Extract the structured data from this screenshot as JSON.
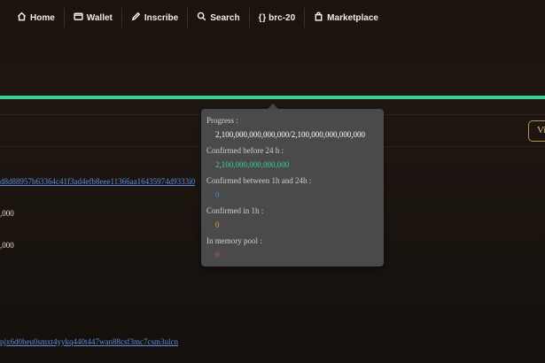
{
  "nav": {
    "items": [
      {
        "label": "Home",
        "icon": "home-icon"
      },
      {
        "label": "Wallet",
        "icon": "wallet-icon"
      },
      {
        "label": "Inscribe",
        "icon": "pencil-icon"
      },
      {
        "label": "Search",
        "icon": "search-icon"
      },
      {
        "label": "brc-20",
        "icon": "braces-icon"
      },
      {
        "label": "Marketplace",
        "icon": "bag-icon"
      }
    ]
  },
  "progress": {
    "fraction": 1.0,
    "color": "#3fcf94"
  },
  "view_button": {
    "label": "Vi"
  },
  "rows": {
    "hash": "d8d88957b63364c41f3ad4efb8eee11366aa16435974d9333i0",
    "amount_1": ",000",
    "amount_2": ",000",
    "address": "pjx6d0heu0smxt4yykq440t447wan88csf3mc7csm3ulcn"
  },
  "tooltip": {
    "progress_label": "Progress :",
    "progress_value": "2,100,000,000,000,000/2,100,000,000,000,000",
    "confirmed_24h_label": "Confirmed before 24 h :",
    "confirmed_24h_value": "2,100,000,000,000,000",
    "confirmed_1h_24h_label": "Confirmed between 1h and 24h :",
    "confirmed_1h_24h_value": "0",
    "confirmed_1h_label": "Confirmed in 1h :",
    "confirmed_1h_value": "0",
    "mempool_label": "In memory pool :",
    "mempool_value": "0",
    "colors": {
      "confirmed_24h": "#3fcf94",
      "confirmed_1h_24h": "#4f87e6",
      "confirmed_1h": "#e8a23a",
      "mempool": "#e2554d"
    }
  }
}
